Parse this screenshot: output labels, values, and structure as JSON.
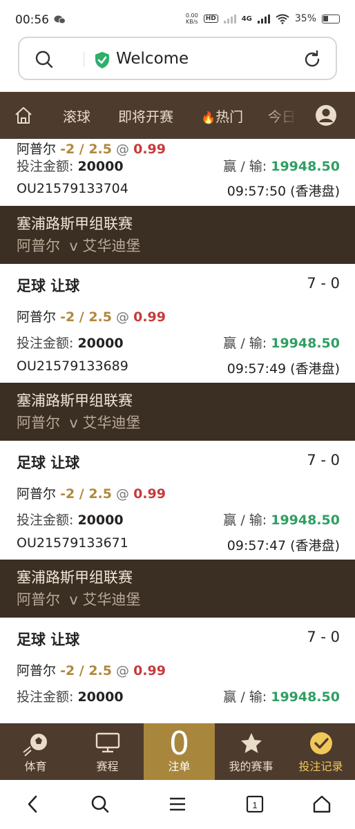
{
  "status_bar": {
    "time": "00:56",
    "net_speed_value": "0.00",
    "net_speed_unit": "KB/s",
    "hd_label": "HD",
    "network": "4G",
    "battery": "35%"
  },
  "browser": {
    "title": "Welcome",
    "icons": [
      "search-icon",
      "shield-check-icon",
      "reload-icon"
    ]
  },
  "nav": {
    "items": [
      "滚球",
      "即将开赛",
      "热门",
      "今日"
    ],
    "hot_emoji": "🔥",
    "icons": [
      "home-icon",
      "user-icon"
    ]
  },
  "partial_top": {
    "bet_amount_label": "投注金额:",
    "bet_amount": "20000",
    "winloss_label": "赢 / 输:",
    "winloss": "19948.50",
    "order_id": "OU21579133704",
    "time_market": "09:57:50 (香港盘)"
  },
  "bets": [
    {
      "league": "塞浦路斯甲组联赛",
      "home": "阿普尔",
      "vs": "v",
      "away": "艾华迪堡",
      "bet_type": "足球 让球",
      "score": "7 - 0",
      "selection": "阿普尔",
      "handicap": "-2 / 2.5",
      "at": "@",
      "odds": "0.99",
      "bet_amount_label": "投注金额:",
      "bet_amount": "20000",
      "winloss_label": "赢 / 输:",
      "winloss": "19948.50",
      "order_id": "OU21579133689",
      "time_market": "09:57:49 (香港盘)"
    },
    {
      "league": "塞浦路斯甲组联赛",
      "home": "阿普尔",
      "vs": "v",
      "away": "艾华迪堡",
      "bet_type": "足球 让球",
      "score": "7 - 0",
      "selection": "阿普尔",
      "handicap": "-2 / 2.5",
      "at": "@",
      "odds": "0.99",
      "bet_amount_label": "投注金额:",
      "bet_amount": "20000",
      "winloss_label": "赢 / 输:",
      "winloss": "19948.50",
      "order_id": "OU21579133671",
      "time_market": "09:57:47 (香港盘)"
    },
    {
      "league": "塞浦路斯甲组联赛",
      "home": "阿普尔",
      "vs": "v",
      "away": "艾华迪堡",
      "bet_type": "足球 让球",
      "score": "7 - 0",
      "selection": "阿普尔",
      "handicap": "-2 / 2.5",
      "at": "@",
      "odds": "0.99",
      "bet_amount_label": "投注金额:",
      "bet_amount": "20000",
      "winloss_label": "赢 / 输:",
      "winloss": "19948.50"
    }
  ],
  "tabs": {
    "sports": "体育",
    "schedule": "赛程",
    "betslip_count": "0",
    "betslip": "注单",
    "my_events": "我的赛事",
    "bet_history": "投注记录"
  },
  "colors": {
    "nav_bg": "#4d3b2e",
    "league_bg": "#3b2e22",
    "active_tab_bg": "#a8873d",
    "handicap": "#b0883c",
    "odds": "#c73a3a",
    "winloss": "#2f9e62"
  }
}
